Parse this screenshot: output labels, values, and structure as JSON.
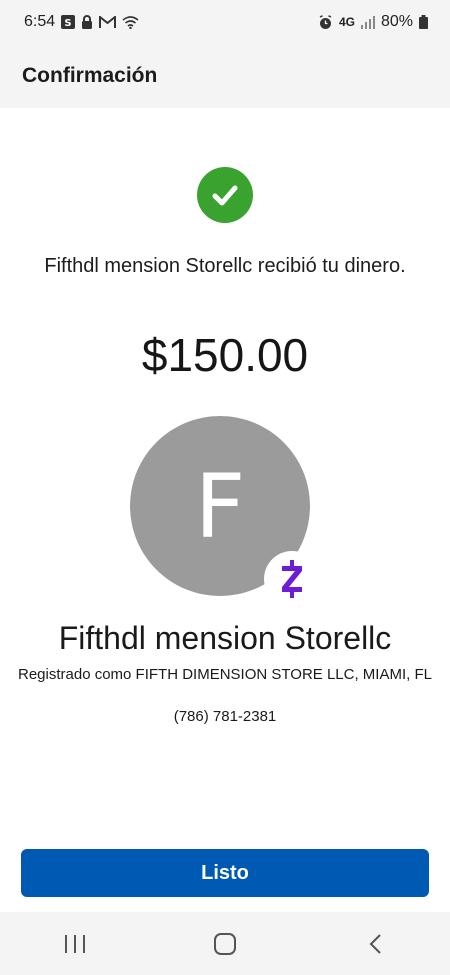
{
  "status_bar": {
    "time": "6:54",
    "battery": "80%",
    "network": "4G",
    "icons_left": [
      "s-app-icon",
      "lock-icon",
      "gmail-icon",
      "wifi-icon"
    ],
    "icons_right": [
      "alarm-icon",
      "signal-icon",
      "battery-icon"
    ]
  },
  "header": {
    "title": "Confirmación"
  },
  "confirmation": {
    "message": "Fifthdl mension Storellc recibió tu dinero.",
    "amount": "$150.00"
  },
  "recipient": {
    "initial": "F",
    "name": "Fifthdl mension Storellc",
    "registered_as": "Registrado como FIFTH DIMENSION STORE LLC, MIAMI, FL",
    "phone": "(786) 781-2381"
  },
  "actions": {
    "done_label": "Listo"
  },
  "colors": {
    "success_green": "#3aa32f",
    "primary_blue": "#0059b3",
    "zelle_purple": "#6d1ed4",
    "avatar_gray": "#9b9b9b"
  }
}
